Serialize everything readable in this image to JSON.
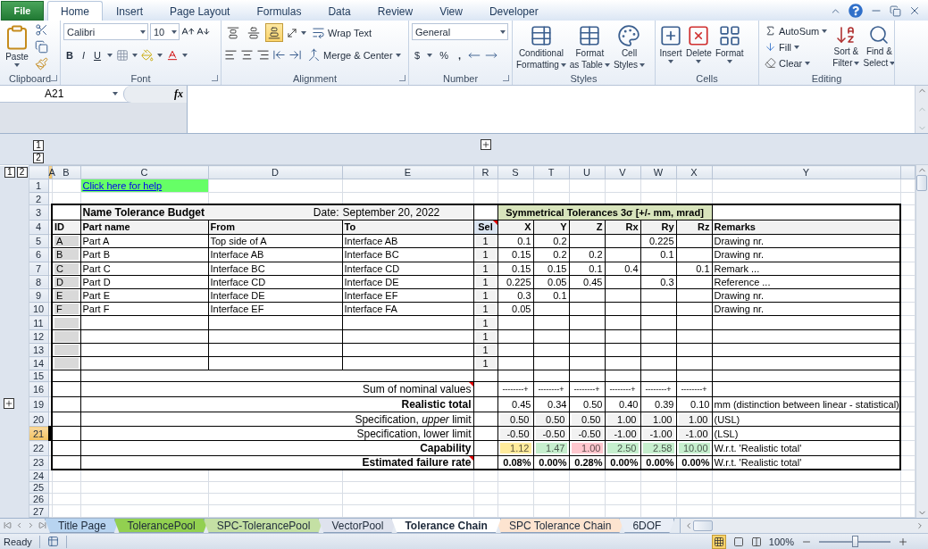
{
  "ribbon": {
    "file_tab": "File",
    "tabs": [
      {
        "label": "Home",
        "selected": true
      },
      {
        "label": "Insert",
        "selected": false
      },
      {
        "label": "Page Layout",
        "selected": false
      },
      {
        "label": "Formulas",
        "selected": false
      },
      {
        "label": "Data",
        "selected": false
      },
      {
        "label": "Review",
        "selected": false
      },
      {
        "label": "View",
        "selected": false
      },
      {
        "label": "Developer",
        "selected": false
      }
    ],
    "clipboard": {
      "label": "Clipboard",
      "paste": "Paste"
    },
    "font": {
      "label": "Font",
      "name": "Calibri",
      "size": "10",
      "bold": "B",
      "italic": "I",
      "underline": "U"
    },
    "alignment": {
      "label": "Alignment",
      "bottom_align_selected": true,
      "wrap_text": "Wrap Text",
      "merge": "Merge & Center"
    },
    "number": {
      "label": "Number",
      "format": "General",
      "currency": "$",
      "percent": "%",
      "comma": ","
    },
    "styles": {
      "label": "Styles",
      "buttons": [
        {
          "lines": [
            "Conditional",
            "Formatting"
          ]
        },
        {
          "lines": [
            "Format",
            "as Table"
          ]
        },
        {
          "lines": [
            "Cell",
            "Styles"
          ]
        }
      ]
    },
    "cells": {
      "label": "Cells",
      "buttons": [
        "Insert",
        "Delete",
        "Format"
      ]
    },
    "editing": {
      "label": "Editing",
      "autosum": "AutoSum",
      "fill": "Fill",
      "clear": "Clear",
      "sort": [
        "Sort &",
        "Filter"
      ],
      "find": [
        "Find &",
        "Select"
      ]
    }
  },
  "formula_bar": {
    "name_box": "A21",
    "fx": "fx"
  },
  "outline": {
    "column_levels": [
      "1",
      "2"
    ],
    "row_levels": [
      "1",
      "2"
    ]
  },
  "sheet": {
    "columns": [
      {
        "label": "A",
        "selected": true
      },
      {
        "label": "B",
        "selected": false
      },
      {
        "label": "C",
        "selected": false
      },
      {
        "label": "D",
        "selected": false
      },
      {
        "label": "E",
        "selected": false
      },
      {
        "label": "R",
        "selected": false
      },
      {
        "label": "S",
        "selected": false
      },
      {
        "label": "T",
        "selected": false
      },
      {
        "label": "U",
        "selected": false
      },
      {
        "label": "V",
        "selected": false
      },
      {
        "label": "W",
        "selected": false
      },
      {
        "label": "X",
        "selected": false
      },
      {
        "label": "Y",
        "selected": false
      }
    ],
    "rows": [
      {
        "number": "1",
        "selected": false,
        "kind": "link",
        "link": "Click here for help"
      },
      {
        "number": "2",
        "selected": false,
        "kind": "blank"
      },
      {
        "number": "3",
        "selected": false,
        "kind": "title",
        "title": "Name Tolerance Budget",
        "date_label": "Date:",
        "date": "September 20, 2022",
        "group_title": "Symmetrical Tolerances 3σ [+/- mm, mrad]"
      },
      {
        "number": "4",
        "selected": false,
        "kind": "header",
        "id": "ID",
        "part": "Part name",
        "from": "From",
        "to": "To",
        "sel": "Sel",
        "comment": true,
        "values": [
          "X",
          "Y",
          "Z",
          "Rx",
          "Ry",
          "Rz"
        ],
        "remarks": "Remarks"
      },
      {
        "number": "5",
        "selected": false,
        "kind": "part",
        "id": "A",
        "part": "Part A",
        "from": "Top side of A",
        "to": "Interface AB",
        "sel": "1",
        "values": {
          "c1": "0.1",
          "c2": "0.2",
          "c5": "0.225"
        },
        "remarks": "Drawing nr."
      },
      {
        "number": "6",
        "selected": false,
        "kind": "part",
        "id": "B",
        "part": "Part B",
        "from": "Interface AB",
        "to": "Interface BC",
        "sel": "1",
        "values": {
          "c1": "0.15",
          "c2": "0.2",
          "c3": "0.2",
          "c5": "0.1"
        },
        "remarks": "Drawing nr."
      },
      {
        "number": "7",
        "selected": false,
        "kind": "part",
        "id": "C",
        "part": "Part C",
        "from": "Interface BC",
        "to": "Interface CD",
        "sel": "1",
        "values": {
          "c1": "0.15",
          "c2": "0.15",
          "c3": "0.1",
          "c4": "0.4",
          "c6": "0.1"
        },
        "remarks": "Remark ..."
      },
      {
        "number": "8",
        "selected": false,
        "kind": "part",
        "id": "D",
        "part": "Part D",
        "from": "Interface CD",
        "to": "Interface DE",
        "sel": "1",
        "values": {
          "c1": "0.225",
          "c2": "0.05",
          "c3": "0.45",
          "c5": "0.3"
        },
        "remarks": "Reference ..."
      },
      {
        "number": "9",
        "selected": false,
        "kind": "part",
        "id": "E",
        "part": "Part E",
        "from": "Interface DE",
        "to": "Interface EF",
        "sel": "1",
        "values": {
          "c1": "0.3",
          "c2": "0.1"
        },
        "remarks": "Drawing nr."
      },
      {
        "number": "10",
        "selected": false,
        "kind": "part",
        "id": "F",
        "part": "Part F",
        "from": "Interface EF",
        "to": "Interface FA",
        "sel": "1",
        "values": {
          "c1": "0.05"
        },
        "remarks": "Drawing nr."
      },
      {
        "number": "11",
        "selected": false,
        "kind": "part",
        "sel": "1"
      },
      {
        "number": "12",
        "selected": false,
        "kind": "part",
        "sel": "1"
      },
      {
        "number": "13",
        "selected": false,
        "kind": "part",
        "sel": "1"
      },
      {
        "number": "14",
        "selected": false,
        "kind": "part",
        "sel": "1"
      },
      {
        "number": "15",
        "selected": false,
        "kind": "spacer"
      },
      {
        "number": "16",
        "selected": false,
        "kind": "sum",
        "label": "Sum of nominal values",
        "comment": true,
        "values": [
          "--------+",
          "--------+",
          "--------+",
          "--------+",
          "--------+",
          "--------+"
        ]
      },
      {
        "number": "19",
        "selected": false,
        "kind": "total",
        "label": "Realistic total",
        "comment": false,
        "expandable": true,
        "values": [
          "0.45",
          "0.34",
          "0.50",
          "0.40",
          "0.39",
          "0.10"
        ],
        "remarks": "mm (distinction between linear - statistical)"
      },
      {
        "number": "20",
        "selected": false,
        "kind": "limit",
        "label": "Specification, *upper* limit",
        "comment": false,
        "values": [
          "0.50",
          "0.50",
          "0.50",
          "1.00",
          "1.00",
          "1.00"
        ],
        "remarks": "(USL)"
      },
      {
        "number": "21",
        "selected": true,
        "kind": "limit",
        "label": "Specification, lower limit",
        "comment": false,
        "values": [
          "-0.50",
          "-0.50",
          "-0.50",
          "-1.00",
          "-1.00",
          "-1.00"
        ],
        "remarks": "(LSL)"
      },
      {
        "number": "22",
        "selected": false,
        "kind": "capability",
        "label": "Capability",
        "comment": false,
        "values": [
          {
            "text": "1.12",
            "color": "#ffeb9c"
          },
          {
            "text": "1.47",
            "color": "#c6efce"
          },
          {
            "text": "1.00",
            "color": "#ffc7ce"
          },
          {
            "text": "2.50",
            "color": "#c6efce"
          },
          {
            "text": "2.58",
            "color": "#c6efce"
          },
          {
            "text": "10.00",
            "color": "#c6efce"
          }
        ],
        "remarks": "W.r.t. 'Realistic total'"
      },
      {
        "number": "23",
        "selected": false,
        "kind": "failure",
        "label": "Estimated failure rate",
        "comment": true,
        "values": [
          "0.08%",
          "0.00%",
          "0.28%",
          "0.00%",
          "0.00%",
          "0.00%"
        ],
        "remarks": "W.r.t. 'Realistic total'"
      },
      {
        "number": "24",
        "selected": false,
        "kind": "blank"
      },
      {
        "number": "25",
        "selected": false,
        "kind": "blank"
      },
      {
        "number": "26",
        "selected": false,
        "kind": "blank"
      },
      {
        "number": "27",
        "selected": false,
        "kind": "blank"
      }
    ]
  },
  "sheet_tabs": [
    {
      "label": "Title Page",
      "color": "#b8d4f0",
      "selected": false
    },
    {
      "label": "TolerancePool",
      "color": "#92d050",
      "selected": false
    },
    {
      "label": "SPC-TolerancePool",
      "color": "#c4e0a4",
      "selected": false
    },
    {
      "label": "VectorPool",
      "color": "#dfe3ee",
      "selected": false
    },
    {
      "label": "Tolerance Chain",
      "color": "#ffffff",
      "selected": true
    },
    {
      "label": "SPC Tolerance Chain",
      "color": "#fde4d0",
      "selected": false
    },
    {
      "label": "6DOF",
      "color": "#e9eef6",
      "selected": false
    }
  ],
  "status_bar": {
    "status": "Ready",
    "zoom": "100%",
    "zoom_slider": {
      "level": 0.5
    }
  }
}
